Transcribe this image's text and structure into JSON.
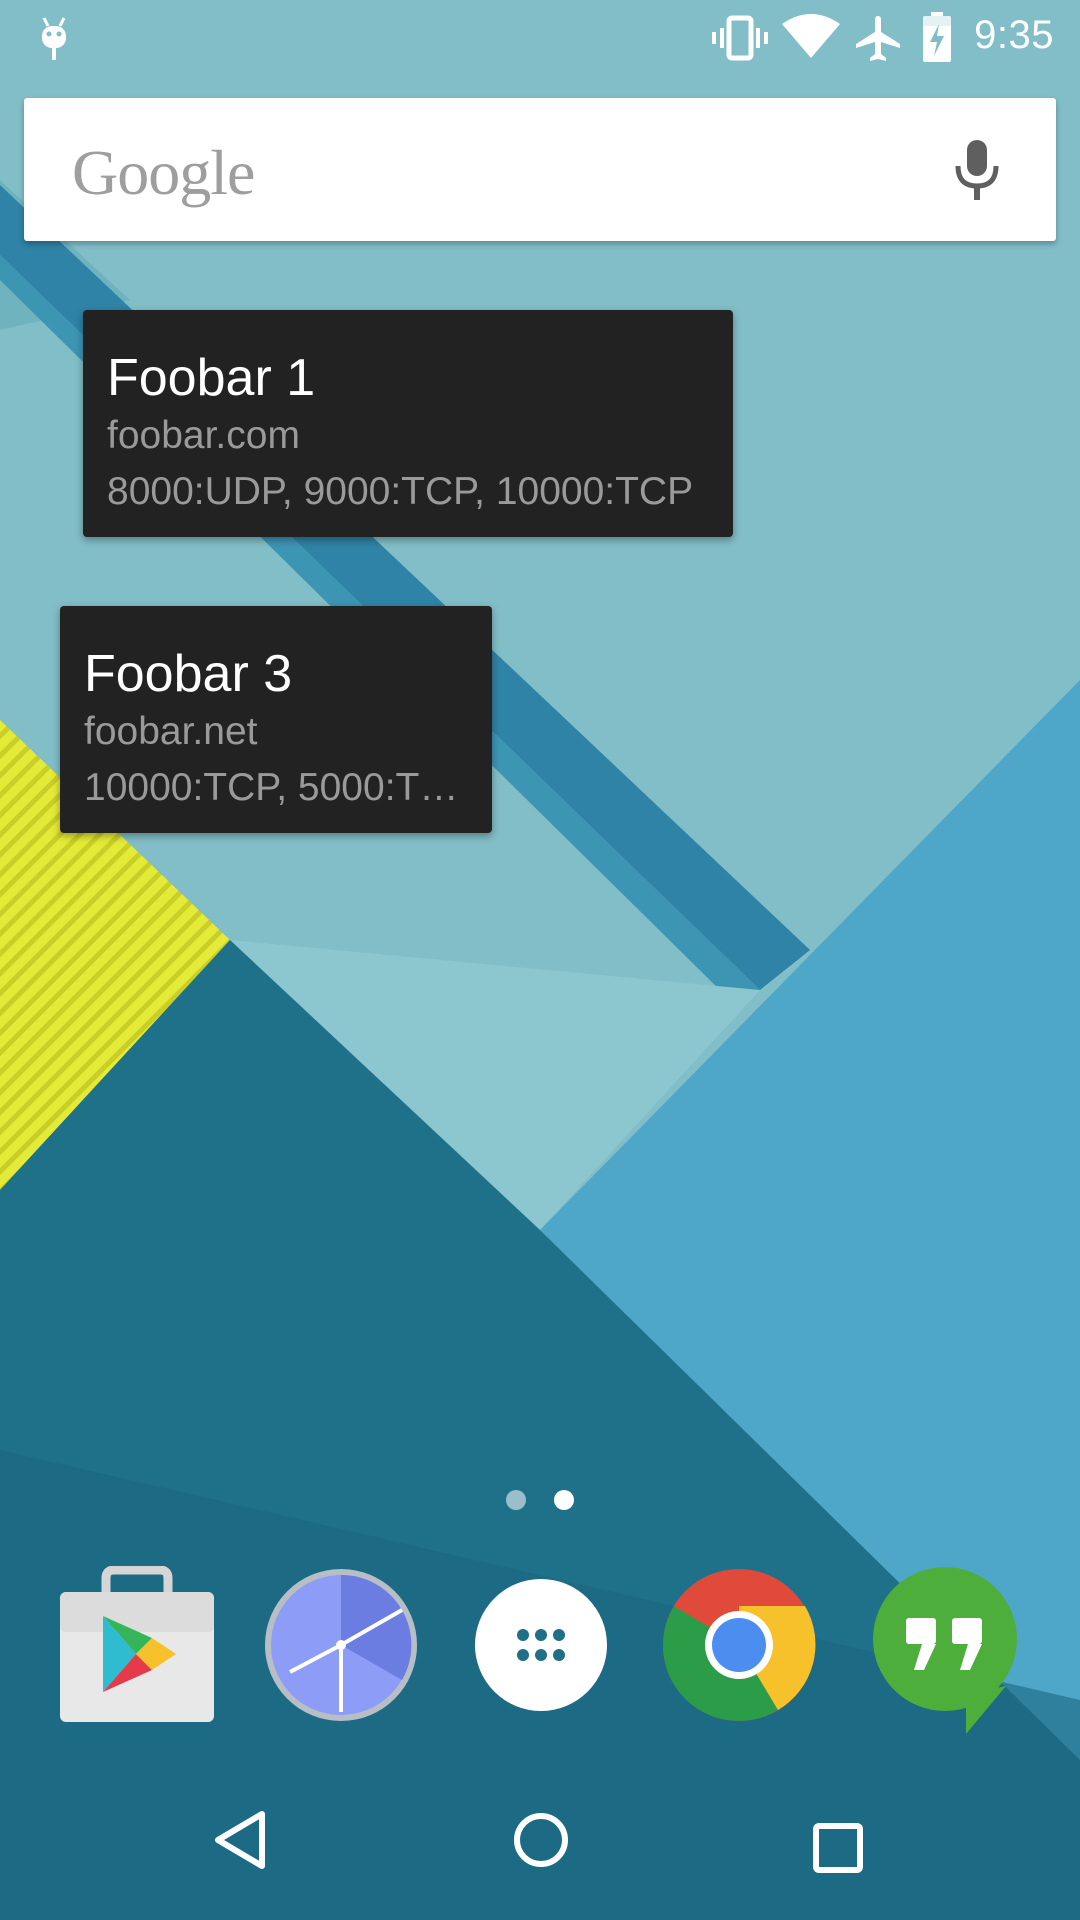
{
  "status_bar": {
    "time": "9:35",
    "icons": [
      "android-debug-icon",
      "vibrate-icon",
      "wifi-icon",
      "airplane-mode-icon",
      "battery-charging-icon"
    ]
  },
  "search": {
    "logo_text": "Google",
    "icon": "mic-icon"
  },
  "widgets": [
    {
      "title": "Foobar 1",
      "host": "foobar.com",
      "ports": "8000:UDP, 9000:TCP, 10000:TCP"
    },
    {
      "title": "Foobar 3",
      "host": "foobar.net",
      "ports": "10000:TCP, 5000:T…"
    }
  ],
  "page_indicator": {
    "pages": 2,
    "current": 2
  },
  "dock": {
    "apps": [
      "play-store-icon",
      "clock-icon",
      "app-drawer-icon",
      "chrome-icon",
      "hangouts-icon"
    ]
  },
  "nav_bar": {
    "buttons": [
      "back-icon",
      "home-icon",
      "recents-icon"
    ]
  },
  "colors": {
    "widget_bg": "#222222",
    "widget_title": "#ffffff",
    "widget_text": "#9a9a9a",
    "wallpaper_teal": "#7ebcc4",
    "wallpaper_dark": "#1b6b83",
    "wallpaper_yellow": "#e6ec3a"
  }
}
